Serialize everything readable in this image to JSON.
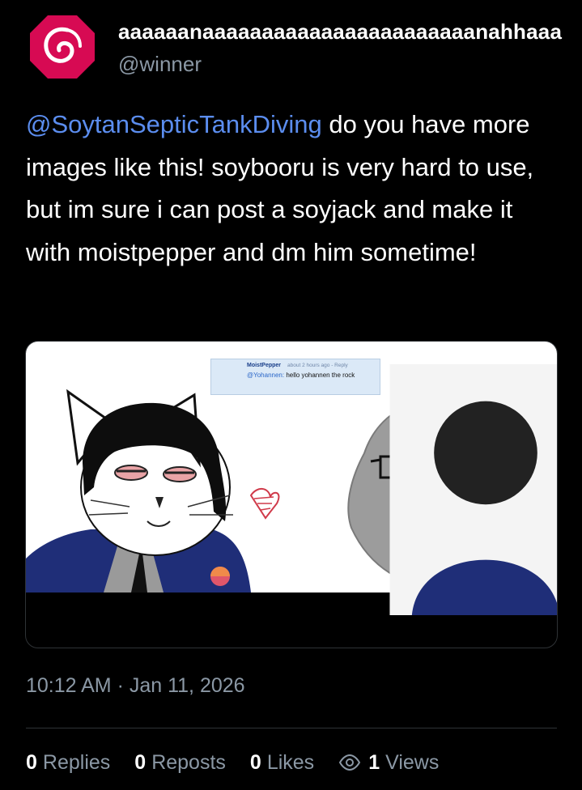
{
  "author": {
    "display_name": "aaaaaanaaaaaaaaaaaaaaaaaaaaaaanahhaaa",
    "handle": "@winner",
    "avatar_icon": "debian-swirl-icon",
    "avatar_color": "#d70a53"
  },
  "post": {
    "mention": "@SoytanSepticTankDiving",
    "text": " do you have more images like this! soybooru is very hard to use, but im sure i can post a soyjack and make it with moistpepper and dm him sometime!",
    "mention_color": "#5b8def"
  },
  "media": {
    "inset_comment": {
      "author": "MoistPepper",
      "meta": "about 2 hours ago - Reply",
      "mention": "@Yohannen:",
      "body": " hello yohannen the rock"
    }
  },
  "timestamp": "10:12 AM · Jan 11, 2026",
  "stats": {
    "replies_count": "0",
    "replies_label": "Replies",
    "reposts_count": "0",
    "reposts_label": "Reposts",
    "likes_count": "0",
    "likes_label": "Likes",
    "views_icon": "eye-icon",
    "views_count": "1",
    "views_label": "Views"
  }
}
